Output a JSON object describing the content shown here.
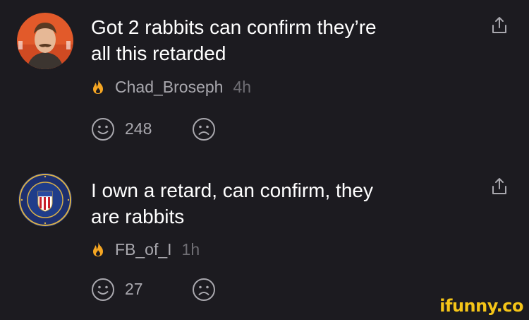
{
  "comments": [
    {
      "text": "Got 2 rabbits can confirm they’re\nall this retarded",
      "username": "Chad_Broseph",
      "time": "4h",
      "smile_count": "248",
      "avatar_icon": "person-photo-avatar",
      "badge_icon": "flame-icon"
    },
    {
      "text": "I own a retard, can confirm, they\nare rabbits",
      "username": "FB_of_I",
      "time": "1h",
      "smile_count": "27",
      "avatar_icon": "fbi-seal-avatar",
      "badge_icon": "flame-icon"
    }
  ],
  "watermark": "ifunny.co",
  "colors": {
    "background": "#1c1b20",
    "text": "#ffffff",
    "secondary": "#a9a8ae",
    "muted": "#6f6e74",
    "flame": "#f5a623",
    "watermark": "#f5c518"
  }
}
